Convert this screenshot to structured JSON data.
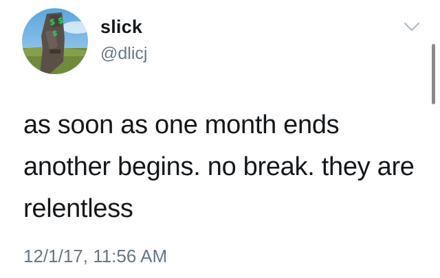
{
  "tweet": {
    "avatar_icon": "moai-statue-avatar",
    "display_name": "slick",
    "handle": "@dlicj",
    "menu_icon": "chevron-down-icon",
    "text": "as soon as one month ends another begins. no break. they are relentless",
    "timestamp": "12/1/17, 11:56 AM"
  },
  "colors": {
    "name": "#14171a",
    "secondary": "#657786",
    "chevron": "#aab8c2"
  }
}
